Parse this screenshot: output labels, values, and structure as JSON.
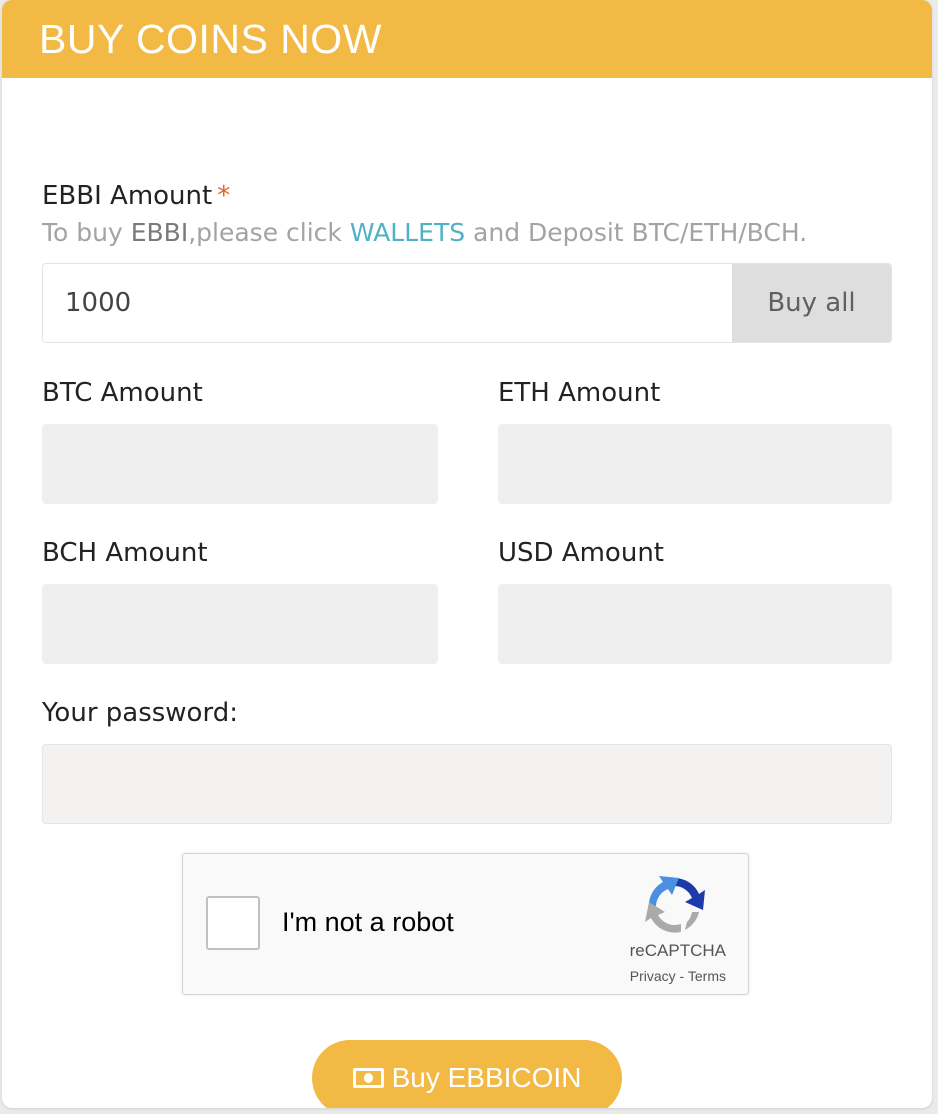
{
  "header": {
    "title": "BUY COINS NOW"
  },
  "form": {
    "ebbi_label": "EBBI Amount",
    "required_mark": "*",
    "hint": {
      "prefix": "To buy ",
      "coin": "EBBI",
      "middle": ",please click ",
      "link": "WALLETS",
      "suffix": " and Deposit BTC/ETH/BCH."
    },
    "ebbi_value": "1000",
    "buy_all_label": "Buy all",
    "btc_label": "BTC Amount",
    "eth_label": "ETH Amount",
    "bch_label": "BCH Amount",
    "usd_label": "USD Amount",
    "password_label": "Your password:",
    "btc_value": "",
    "eth_value": "",
    "bch_value": "",
    "usd_value": ""
  },
  "captcha": {
    "label": "I'm not a robot",
    "brand": "reCAPTCHA",
    "privacy": "Privacy",
    "separator": " - ",
    "terms": "Terms"
  },
  "submit": {
    "label": "Buy EBBICOIN",
    "icon": "money-icon"
  },
  "colors": {
    "accent": "#f2b945",
    "link": "#4fb0c6",
    "required": "#e8612a"
  }
}
